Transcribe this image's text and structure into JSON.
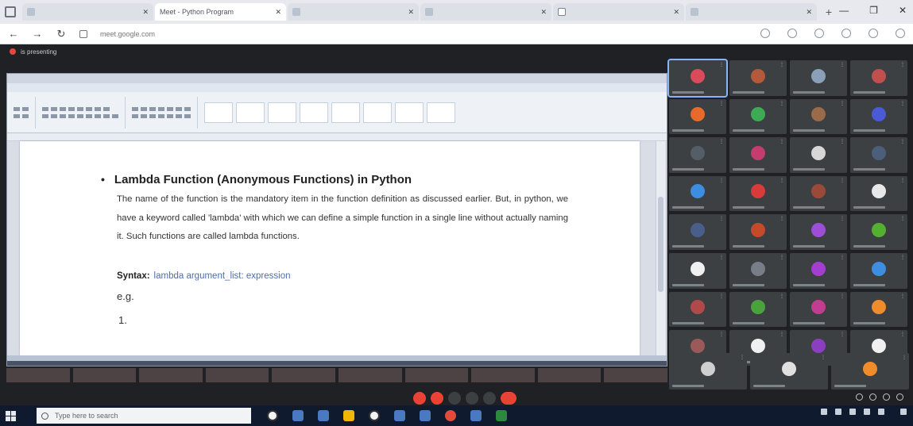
{
  "browser": {
    "tabs": [
      {
        "title": "",
        "active": false,
        "favicon": "generic"
      },
      {
        "title": "Meet - Python Program",
        "active": true,
        "favicon": "meet"
      },
      {
        "title": "",
        "active": false,
        "favicon": "generic"
      },
      {
        "title": "",
        "active": false,
        "favicon": "generic"
      },
      {
        "title": "",
        "active": false,
        "favicon": "file"
      },
      {
        "title": "",
        "active": false,
        "favicon": "generic"
      }
    ],
    "url": "meet.google.com",
    "new_tab_label": "+"
  },
  "meet": {
    "presenter_label": "is presenting"
  },
  "document": {
    "heading_bullet": "•",
    "heading": "Lambda Function (Anonymous Functions) in Python",
    "paragraph": "The name of the function is the mandatory item in the function definition as discussed earlier. But, in python, we have a keyword called 'lambda' with which we can define a simple function in a single line without actually naming it. Such functions are called lambda functions.",
    "syntax_label": "Syntax:",
    "syntax_code": "lambda argument_list: expression",
    "eg": "e.g.",
    "item_number": "1."
  },
  "participants": {
    "avatar_colors": [
      "#d94b5a",
      "#b45a3a",
      "#8aa0b8",
      "#c0504d",
      "#e86a2a",
      "#3dab55",
      "#9a6a4a",
      "#4a59d6",
      "#555d66",
      "#c43d6f",
      "#d7d7d7",
      "#4b5e7a",
      "#3d8de0",
      "#d93a3a",
      "#9b4a3a",
      "#e8e8e8",
      "#4a5e8a",
      "#c44a2a",
      "#9c4fd6",
      "#55b030",
      "#f0f0f0",
      "#777e88",
      "#a23fd0",
      "#3d8de0",
      "#b04a4a",
      "#4aa23d",
      "#c23d8f",
      "#f08c2a",
      "#9a5a5a",
      "#f0f0f0",
      "#8b3fbf",
      "#f0f0f0"
    ],
    "bottom_avatar_colors": [
      "#cfcfcf",
      "#e0e0e0",
      "#f08c2a"
    ]
  },
  "taskbar": {
    "search_placeholder": "Type here to search"
  },
  "colors": {
    "meet_bg": "#202124",
    "tile_bg": "#3c4043",
    "end_call": "#ea4335",
    "taskbar_bg": "#0f1a2e"
  }
}
